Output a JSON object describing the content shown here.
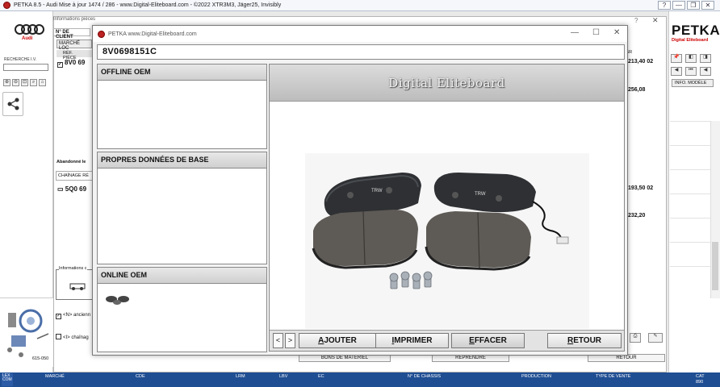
{
  "window": {
    "title": "PETKA 8.5 - Audi Mise à jour 1474 / 286 - www.Digital-Eliteboard.com - ©2022 XTR3M3, Jäger25, Invisibly",
    "controls": [
      "?",
      "—",
      "❐",
      "✕"
    ]
  },
  "left": {
    "brand_label": "Audi",
    "search_label": "RECHERCHE I.V.",
    "part_number": "615-050"
  },
  "info_window": {
    "title": "Informations pièces",
    "client_label": "N° DE CLIENT",
    "market_tab": "MARCHÉ LOC",
    "col_ref": "RÉF. PIÈCE",
    "row1_ref": "8V0 69",
    "abandoned_label": "Abandonné le",
    "chainage_tab": "CHAÎNAGE RÉ",
    "row2_ref": "5Q0 69",
    "info_label": "Informations c",
    "check1": "<N> ancienn",
    "check2": "<I> chaînag",
    "col_upe_gr": "UPE  GR",
    "val1": "213,40  02",
    "val2": "256,08",
    "val3": "193,50  02",
    "val4": "232,20",
    "btn_bons": "BONS DE MATÉRIEL",
    "btn_reprendre": "REPRENDRE",
    "btn_retour": "RETOUR"
  },
  "right": {
    "brand": "PETKA",
    "brand_sub": "Digital Eliteboard",
    "info_modele": "INFO. MODÈLE"
  },
  "status": {
    "lexcom": "LEX COM",
    "labels": [
      "MARCHÉ",
      "CDE",
      "LRM",
      "LBV",
      "EC",
      "N° DE CHASSIS",
      "PRODUCTION",
      "TYPE DE VENTE"
    ],
    "cat_label": "CAT",
    "cat_value": "890"
  },
  "popup": {
    "title": "PETKA www.Digital-Eliteboard.com",
    "part_number": "8V0698151C",
    "sections": [
      "OFFLINE OEM",
      "PROPRES DONNÉES DE BASE",
      "ONLINE OEM"
    ],
    "watermark": "Digital Eliteboard",
    "buttons": {
      "prev": "<",
      "next": ">",
      "ajouter": "AJOUTER",
      "imprimer": "IMPRIMER",
      "effacer": "EFFACER",
      "retour": "RETOUR"
    }
  }
}
